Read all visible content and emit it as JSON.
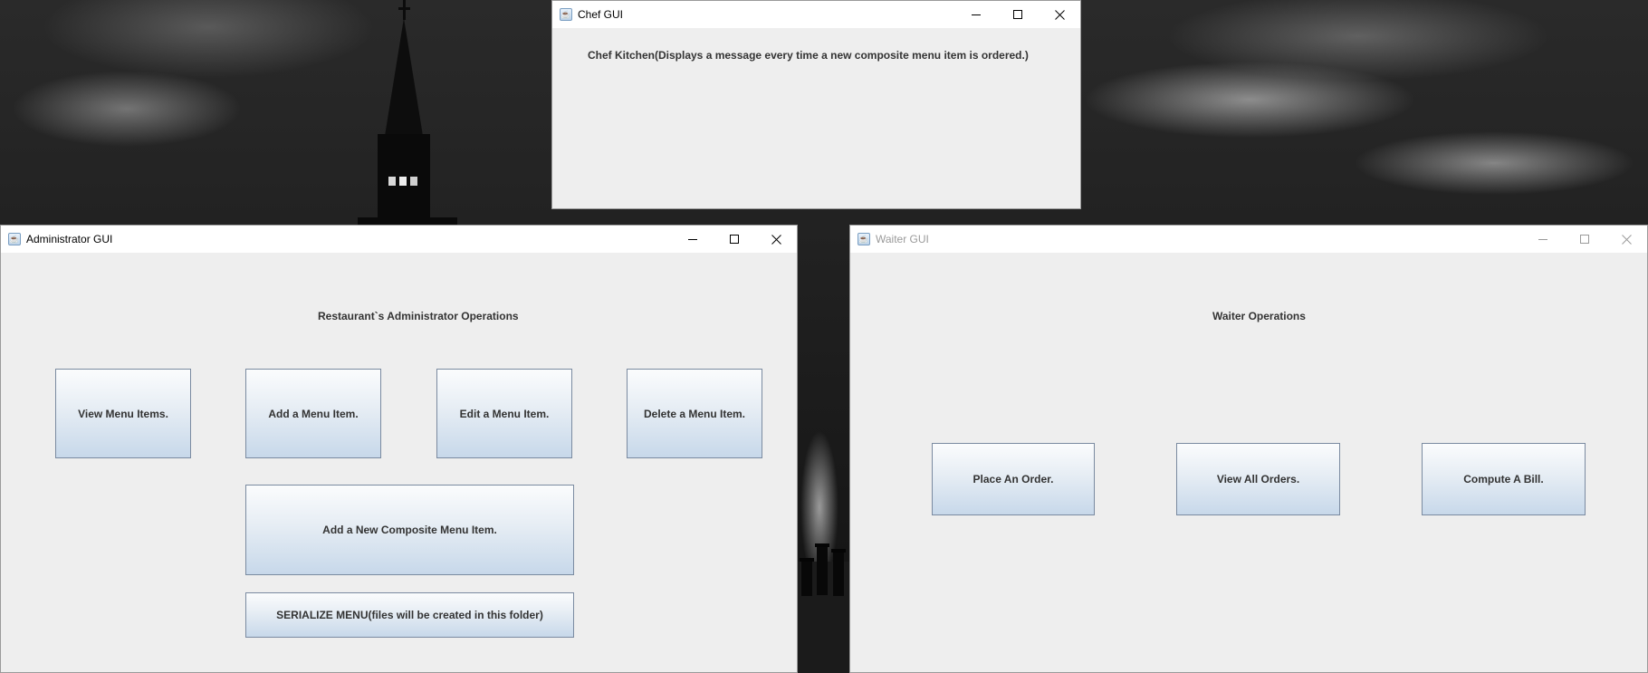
{
  "chef_window": {
    "title": "Chef GUI",
    "message": "Chef Kitchen(Displays a message every time a new composite menu item is ordered.)"
  },
  "admin_window": {
    "title": "Administrator GUI",
    "heading": "Restaurant`s Administrator Operations",
    "buttons": {
      "view": "View Menu Items.",
      "add": "Add a Menu Item.",
      "edit": "Edit a Menu Item.",
      "delete": "Delete a Menu Item.",
      "composite": "Add a New Composite Menu Item.",
      "serialize": "SERIALIZE MENU(files will be created in this folder)"
    }
  },
  "waiter_window": {
    "title": "Waiter GUI",
    "heading": "Waiter Operations",
    "buttons": {
      "place": "Place An Order.",
      "view_all": "View All Orders.",
      "compute": "Compute A Bill."
    }
  },
  "icons": {
    "app": "java-cup-icon",
    "minimize": "minimize-icon",
    "maximize": "maximize-icon",
    "close": "close-icon"
  }
}
